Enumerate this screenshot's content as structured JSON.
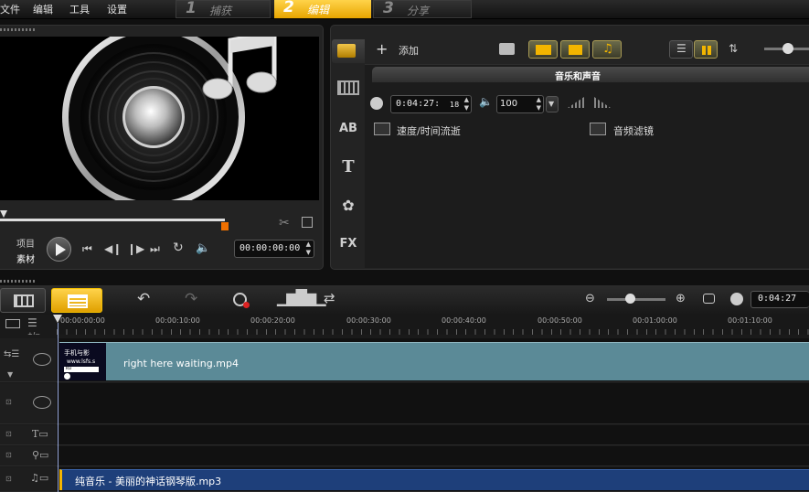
{
  "menu": [
    "文件",
    "编辑",
    "工具",
    "设置"
  ],
  "steps": [
    {
      "num": "1",
      "label": "捕获"
    },
    {
      "num": "2",
      "label": "编辑"
    },
    {
      "num": "3",
      "label": "分享"
    }
  ],
  "preview": {
    "mode_project": "项目",
    "mode_clip": "素材",
    "timecode": "00:00:00:00"
  },
  "library": {
    "add_label": "添加",
    "category_title": "音乐和声音",
    "duration": "0:04:27:",
    "duration_frames": "18",
    "volume": "100",
    "speed_label": "速度/时间流逝",
    "audio_filter_label": "音频滤镜",
    "side_ab": "AB",
    "side_t": "T",
    "side_fx": "FX"
  },
  "timeline": {
    "duration": "0:04:27",
    "ruler_marks": [
      "00:00:00:00",
      "00:00:10:00",
      "00:00:20:00",
      "00:00:30:00",
      "00:00:40:00",
      "00:00:50:00",
      "00:01:00:00",
      "00:01:10:00"
    ],
    "ruler_prefix": "+/−",
    "video_clip": "right here waiting.mp4",
    "thumb_text": [
      "手机与影",
      "www.lsfs.s",
      "ku"
    ],
    "music_clip": "纯音乐 - 美丽的神话钢琴版.mp3"
  },
  "colors": {
    "accent": "#f5b500",
    "video_track": "#5b8a97",
    "audio_track": "#1e3f7a"
  }
}
